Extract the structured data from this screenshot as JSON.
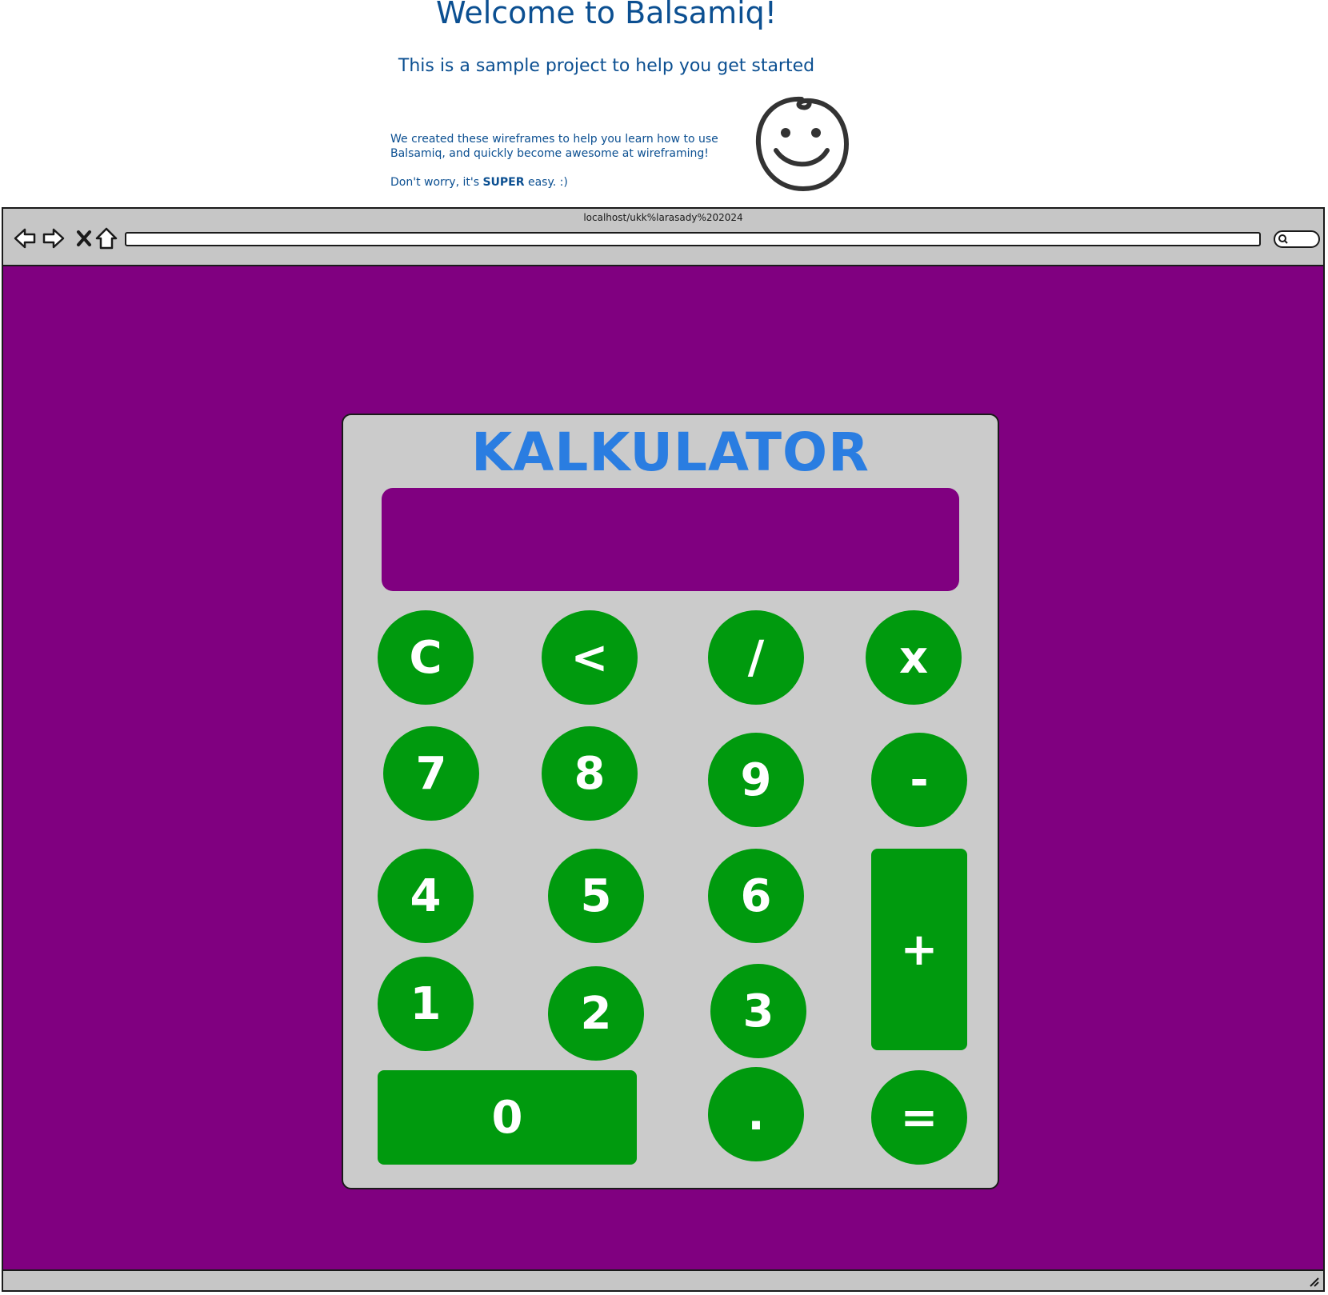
{
  "header": {
    "title": "Welcome to Balsamiq!",
    "subtitle": "This is a sample project to help you get started",
    "body_line1": "We created these wireframes to help you learn how to use Balsamiq, and quickly become awesome at wireframing!",
    "body_line2_prefix": "Don't worry, it's ",
    "body_line2_bold": "SUPER",
    "body_line2_suffix": " easy. :)"
  },
  "browser": {
    "url": "localhost/ukk%larasady%202024",
    "address_value": "",
    "icons": [
      "back-arrow-icon",
      "forward-arrow-icon",
      "close-icon",
      "home-icon",
      "search-icon",
      "resize-grip-icon"
    ]
  },
  "calculator": {
    "title": "KALKULATOR",
    "display_value": "",
    "keys": {
      "clear": "C",
      "backspace": "<",
      "divide": "/",
      "multiply": "x",
      "seven": "7",
      "eight": "8",
      "nine": "9",
      "minus": "-",
      "four": "4",
      "five": "5",
      "six": "6",
      "plus": "+",
      "one": "1",
      "two": "2",
      "three": "3",
      "zero": "0",
      "decimal": ".",
      "equals": "="
    }
  },
  "colors": {
    "page_bg": "#800080",
    "panel_bg": "#cbcbcb",
    "key_bg": "#009a0e",
    "key_text": "#ffffff",
    "title_text": "#2a7de1",
    "header_text": "#0b4f91"
  }
}
